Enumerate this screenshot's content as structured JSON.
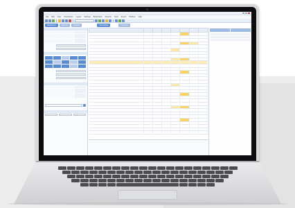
{
  "app": {
    "menu": [
      "File",
      "Edit",
      "View",
      "Procedures",
      "Layout",
      "Settings",
      "Bookmarks",
      "Reports",
      "Tools",
      "Export",
      "Window",
      "Help"
    ],
    "tabs": [
      "Dashboard",
      "Reports",
      "Analysis",
      "Scheduling",
      "Favorites"
    ]
  },
  "colors": {
    "accent": "#5b8bd0",
    "highlight": "#fad26a",
    "selected_row": "#fde9b3"
  },
  "table": {
    "rows": 32
  }
}
